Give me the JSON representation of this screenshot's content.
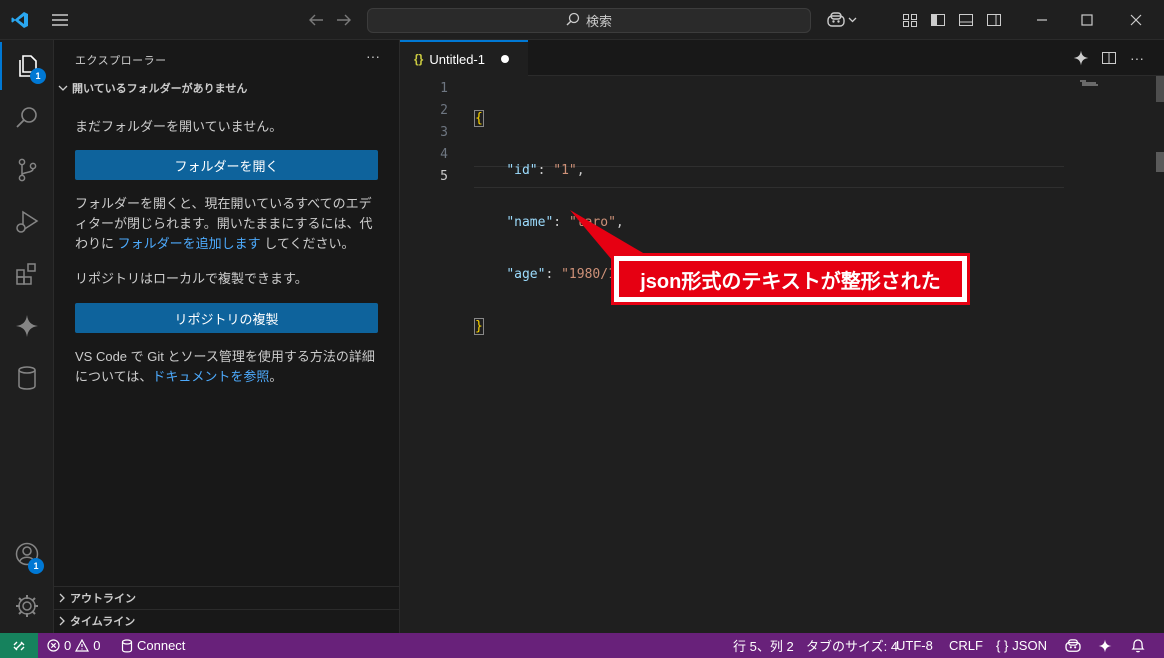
{
  "titlebar": {
    "search_label": "検索",
    "icons": [
      "vscode-logo-icon",
      "menu-icon",
      "back-arrow-icon",
      "forward-arrow-icon",
      "search-icon",
      "copilot-icon",
      "layout-icon",
      "toggle-sidebar-icon",
      "toggle-panel-icon",
      "toggle-secondary-sidebar-icon",
      "minimize-icon",
      "maximize-icon",
      "close-icon"
    ]
  },
  "activitybar": {
    "explorer_badge": "1",
    "accounts_badge": "1",
    "icons": [
      "explorer-icon",
      "search-icon",
      "source-control-icon",
      "run-debug-icon",
      "extensions-icon",
      "copilot-chat-icon",
      "database-icon",
      "accounts-icon",
      "settings-gear-icon"
    ]
  },
  "sidebar": {
    "title": "エクスプローラー",
    "more": "···",
    "section_title": "開いているフォルダーがありません",
    "no_folder_text": "まだフォルダーを開いていません。",
    "open_folder_button": "フォルダーを開く",
    "open_folder_desc_1": "フォルダーを開くと、現在開いているすべてのエディターが閉じられます。開いたままにするには、代わりに ",
    "open_folder_desc_link": "フォルダーを追加します",
    "open_folder_desc_2": " してください。",
    "repo_text": "リポジトリはローカルで複製できます。",
    "clone_button": "リポジトリの複製",
    "git_desc_1": "VS Code で Git とソース管理を使用する方法の詳細については、",
    "git_desc_link": "ドキュメントを参照",
    "git_desc_2": "。",
    "outline_label": "アウトライン",
    "timeline_label": "タイムライン"
  },
  "editor": {
    "tab_icon": "{}",
    "tab_title": "Untitled-1",
    "line_numbers": [
      "1",
      "2",
      "3",
      "4",
      "5"
    ],
    "lines": {
      "l1": "{",
      "l2_key": "\"id\"",
      "l2_colon": ": ",
      "l2_val": "\"1\"",
      "l2_comma": ",",
      "l3_key": "\"name\"",
      "l3_colon": ": ",
      "l3_val": "\"taro\"",
      "l3_comma": ",",
      "l4_key": "\"age\"",
      "l4_colon": ": ",
      "l4_val": "\"1980/1/1\"",
      "l5": "}"
    },
    "indent": "    "
  },
  "callout": {
    "text": "json形式のテキストが整形された",
    "color": "#e60012"
  },
  "statusbar": {
    "errors": "0",
    "warnings": "0",
    "connect": "Connect",
    "position": "行 5、列 2",
    "tab_size": "タブのサイズ: 4",
    "encoding": "UTF-8",
    "eol": "CRLF",
    "language": "JSON",
    "language_icon": "{ }",
    "color": "#68217a"
  }
}
